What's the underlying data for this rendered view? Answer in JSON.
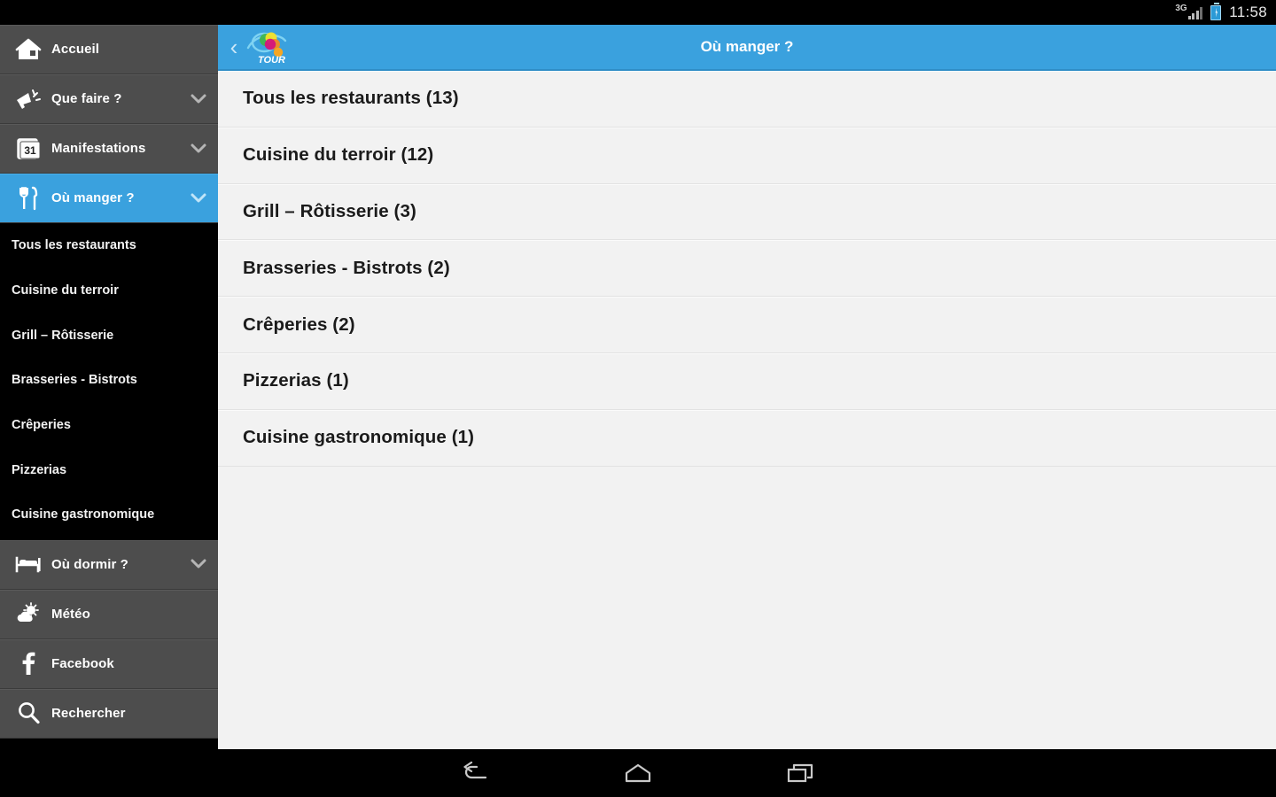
{
  "statusbar": {
    "network": "3G",
    "time": "11:58",
    "icons": [
      "signal-icon",
      "battery-icon"
    ]
  },
  "appbar": {
    "back_label": "‹",
    "title": "Où manger ?",
    "logo_text": "TOUR",
    "accent_color": "#3aa1de"
  },
  "sidebar": {
    "background": "#4d4d4d",
    "active_color": "#3aa1de",
    "items": [
      {
        "label": "Accueil",
        "icon": "home-icon",
        "chevron": false,
        "active": false
      },
      {
        "label": "Que faire ?",
        "icon": "megaphone-icon",
        "chevron": true,
        "active": false
      },
      {
        "label": "Manifestations",
        "icon": "calendar-31-icon",
        "chevron": true,
        "active": false
      },
      {
        "label": "Où manger ?",
        "icon": "cutlery-icon",
        "chevron": true,
        "active": true
      }
    ],
    "sub_items": [
      {
        "label": "Tous les restaurants"
      },
      {
        "label": "Cuisine du terroir"
      },
      {
        "label": "Grill – Rôtisserie"
      },
      {
        "label": "Brasseries - Bistrots"
      },
      {
        "label": "Crêperies"
      },
      {
        "label": "Pizzerias"
      },
      {
        "label": "Cuisine gastronomique"
      }
    ],
    "items_after": [
      {
        "label": "Où dormir ?",
        "icon": "bed-icon",
        "chevron": true,
        "active": false
      },
      {
        "label": "Météo",
        "icon": "weather-icon",
        "chevron": false,
        "active": false
      },
      {
        "label": "Facebook",
        "icon": "facebook-icon",
        "chevron": false,
        "active": false
      },
      {
        "label": "Rechercher",
        "icon": "search-icon",
        "chevron": false,
        "active": false
      }
    ]
  },
  "main": {
    "rows": [
      {
        "label": "Tous les restaurants (13)"
      },
      {
        "label": "Cuisine du terroir (12)"
      },
      {
        "label": "Grill – Rôtisserie (3)"
      },
      {
        "label": "Brasseries - Bistrots (2)"
      },
      {
        "label": "Crêperies (2)"
      },
      {
        "label": "Pizzerias (1)"
      },
      {
        "label": "Cuisine gastronomique (1)"
      }
    ]
  },
  "navbar": {
    "buttons": [
      {
        "name": "back-icon"
      },
      {
        "name": "home-icon"
      },
      {
        "name": "recents-icon"
      }
    ]
  }
}
